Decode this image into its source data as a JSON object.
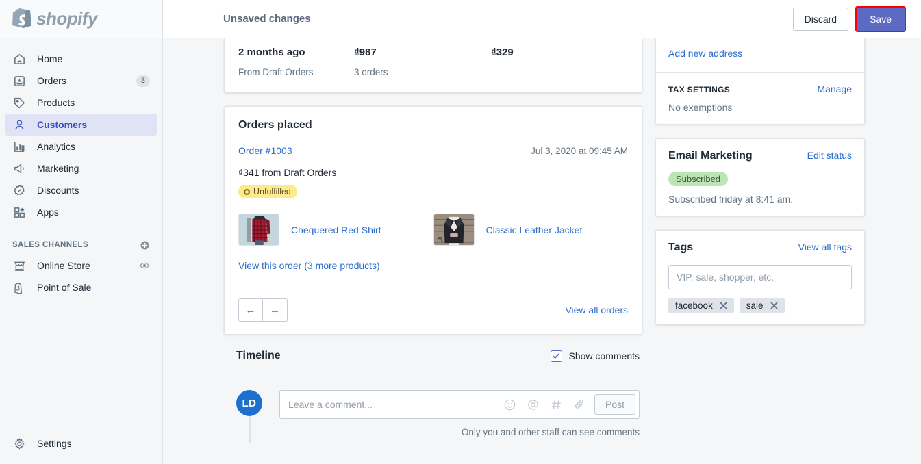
{
  "sidebar": {
    "logo_text": "shopify",
    "items": [
      {
        "label": "Home",
        "icon": "home-icon",
        "badge": ""
      },
      {
        "label": "Orders",
        "icon": "orders-icon",
        "badge": "3"
      },
      {
        "label": "Products",
        "icon": "products-icon",
        "badge": ""
      },
      {
        "label": "Customers",
        "icon": "customers-icon",
        "badge": "",
        "active": true
      },
      {
        "label": "Analytics",
        "icon": "analytics-icon",
        "badge": ""
      },
      {
        "label": "Marketing",
        "icon": "marketing-icon",
        "badge": ""
      },
      {
        "label": "Discounts",
        "icon": "discounts-icon",
        "badge": ""
      },
      {
        "label": "Apps",
        "icon": "apps-icon",
        "badge": ""
      }
    ],
    "sales_channels_header": "SALES CHANNELS",
    "sales_channels": [
      {
        "label": "Online Store",
        "icon": "online-store-icon",
        "trailing_icon": "eye-icon"
      },
      {
        "label": "Point of Sale",
        "icon": "point-of-sale-icon",
        "trailing_icon": ""
      }
    ],
    "settings_label": "Settings"
  },
  "topbar": {
    "title": "Unsaved changes",
    "discard_label": "Discard",
    "save_label": "Save",
    "save_accent": "#5c6ac4",
    "focus_ring_color": "#ff0000"
  },
  "summary": {
    "last_order_value": "2 months ago",
    "last_order_sub": "From Draft Orders",
    "total_spent_value": "₫987",
    "total_spent_sub": "3 orders",
    "average_value": "₫329"
  },
  "orders_placed": {
    "title": "Orders placed",
    "order": {
      "number": "Order #1003",
      "date": "Jul 3, 2020 at 09:45 AM",
      "amount_line": "₫341 from Draft Orders",
      "status": "Unfulfilled",
      "status_bg": "#ffea8a",
      "products": [
        {
          "name": "Chequered Red Shirt",
          "thumb": "red-plaid-shirt-photo"
        },
        {
          "name": "Classic Leather Jacket",
          "thumb": "black-leather-jacket-photo"
        }
      ],
      "view_order_link": "View this order (3 more products)"
    },
    "prev_label": "←",
    "next_label": "→",
    "view_all_label": "View all orders"
  },
  "timeline": {
    "title": "Timeline",
    "show_comments_label": "Show comments",
    "show_comments_checked": true,
    "avatar_initials": "LD",
    "comment_placeholder": "Leave a comment...",
    "comment_value": "",
    "icons": [
      "emoji-icon",
      "mention-icon",
      "hashtag-icon",
      "attachment-icon"
    ],
    "post_label": "Post",
    "note": "Only you and other staff can see comments"
  },
  "right": {
    "add_address_link": "Add new address",
    "tax_settings_caption": "TAX SETTINGS",
    "tax_manage_link": "Manage",
    "tax_value": "No exemptions",
    "email_marketing_title": "Email Marketing",
    "email_edit_link": "Edit status",
    "email_status": "Subscribed",
    "email_status_bg": "#bbe5b3",
    "email_note": "Subscribed friday at 8:41 am.",
    "tags_title": "Tags",
    "view_all_tags_link": "View all tags",
    "tags_placeholder": "VIP, sale, shopper, etc.",
    "tags_value": "",
    "tags": [
      "facebook",
      "sale"
    ]
  }
}
